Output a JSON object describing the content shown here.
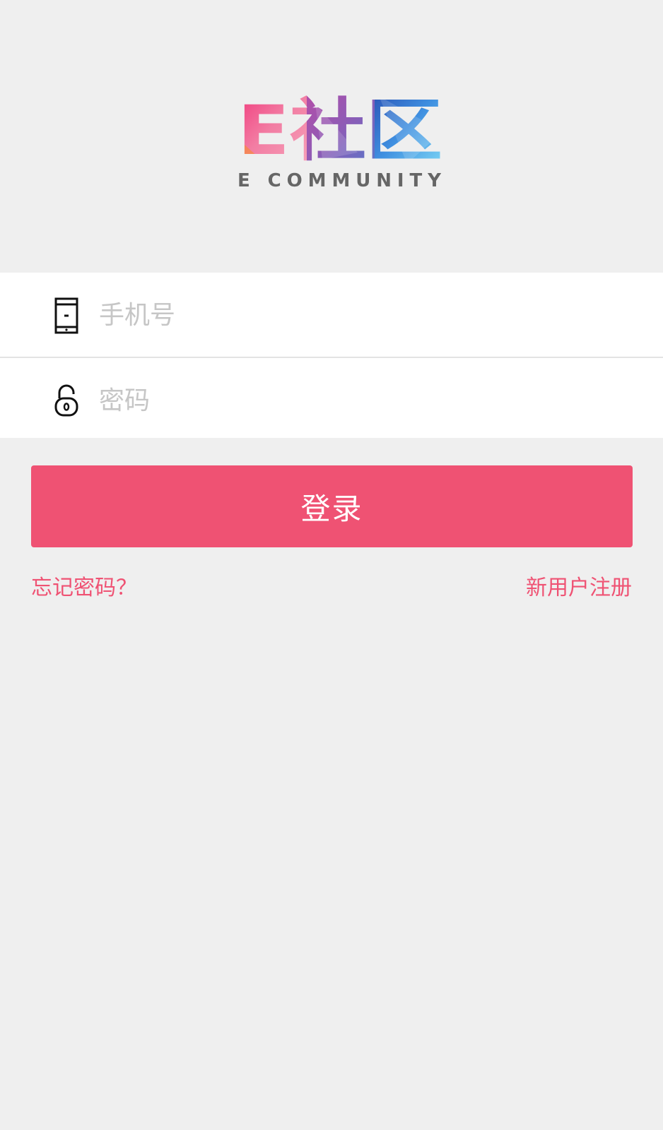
{
  "brand": {
    "logo_cn": "E社区",
    "logo_en": "E COMMUNITY"
  },
  "form": {
    "phone": {
      "icon": "phone-icon",
      "placeholder": "手机号",
      "value": ""
    },
    "password": {
      "icon": "lock-icon",
      "placeholder": "密码",
      "value": ""
    }
  },
  "actions": {
    "login_label": "登录",
    "forgot_password": "忘记密码？",
    "register": "新用户注册"
  },
  "colors": {
    "accent": "#ef5273",
    "background": "#efefef",
    "logo_en": "#666666"
  }
}
